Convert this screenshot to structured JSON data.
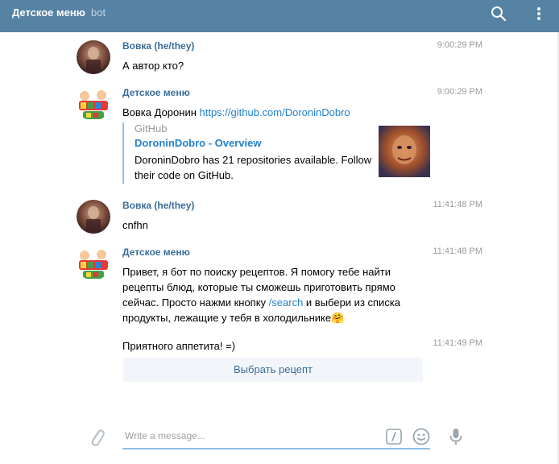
{
  "header": {
    "title": "Детское меню",
    "subtitle": "bot"
  },
  "messages": [
    {
      "author": "Вовка (he/they)",
      "time": "9:00:29 PM",
      "text": "А автор кто?"
    },
    {
      "author": "Детское меню",
      "time": "9:00:29 PM",
      "text_prefix": "Вовка Доронин ",
      "link": "https://github.com/DoroninDobro",
      "preview": {
        "site": "GitHub",
        "title": "DoroninDobro - Overview",
        "description": "DoroninDobro has 21 repositories available. Follow their code on GitHub."
      }
    },
    {
      "author": "Вовка (he/they)",
      "time": "11:41:48 PM",
      "text": "cnfhn"
    },
    {
      "author": "Детское меню",
      "time": "11:41:48 PM",
      "text_before": "Привет, я бот по поиску рецептов. Я помогу тебе найти рецепты блюд, которые ты сможешь приготовить прямо сейчас. Просто нажми кнопку ",
      "command": "/search",
      "text_after": " и выбери из списка продукты, лежащие у тебя в холодильнике🤗"
    },
    {
      "time": "11:41:49 PM",
      "text": "Приятного аппетита! =)",
      "button": "Выбрать рецепт"
    }
  ],
  "composer": {
    "placeholder": "Write a message..."
  },
  "colors": {
    "header": "#5682a3",
    "author": "#3a6d99",
    "link": "#2481cc",
    "input_underline": "#8fbfe5"
  },
  "icons": [
    "search-icon",
    "more-vertical-icon",
    "attach-icon",
    "bot-command-icon",
    "emoji-icon",
    "microphone-icon"
  ]
}
